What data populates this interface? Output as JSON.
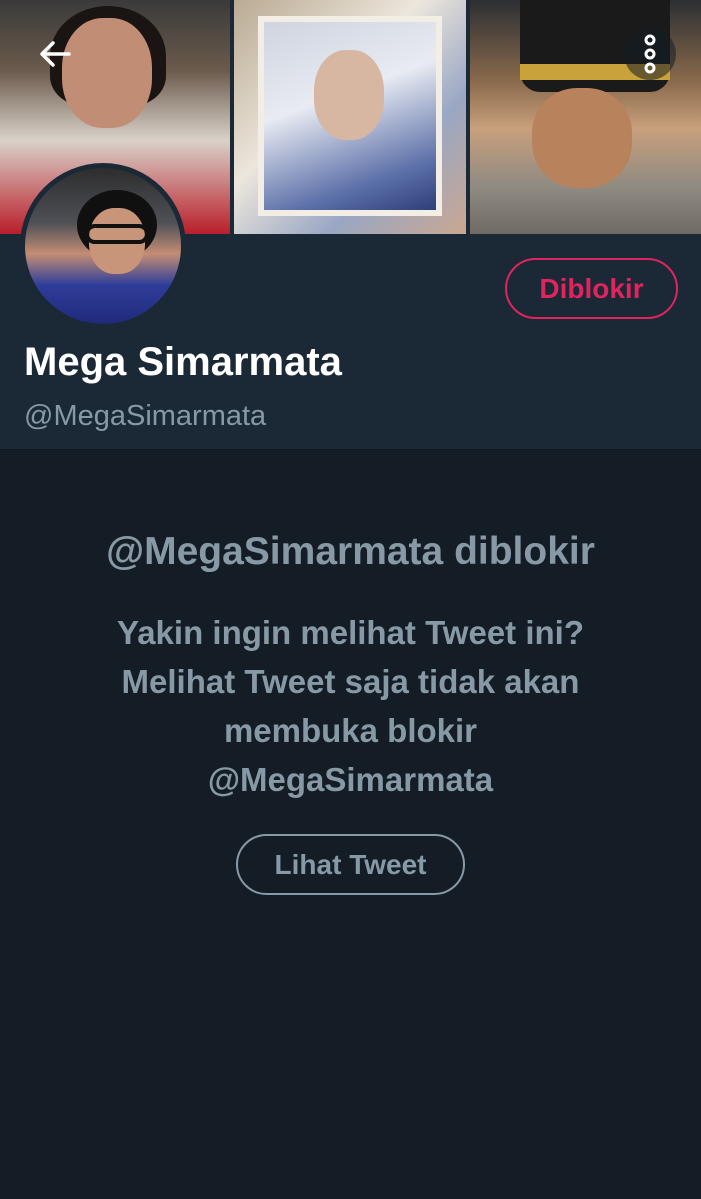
{
  "header": {
    "back_icon": "arrow-left-icon",
    "more_icon": "more-vertical-icon"
  },
  "profile": {
    "display_name": "Mega Simarmata",
    "handle": "@MegaSimarmata",
    "blocked_button_label": "Diblokir"
  },
  "blocked_notice": {
    "title": "@MegaSimarmata diblokir",
    "message": "Yakin ingin melihat Tweet ini? Melihat Tweet saja tidak akan membuka blokir @MegaSimarmata",
    "view_button_label": "Lihat Tweet"
  },
  "colors": {
    "background": "#141d26",
    "panel": "#1b2836",
    "blocked_accent": "#e0245e",
    "muted_text": "#8899a6",
    "name_text": "#ffffff"
  }
}
